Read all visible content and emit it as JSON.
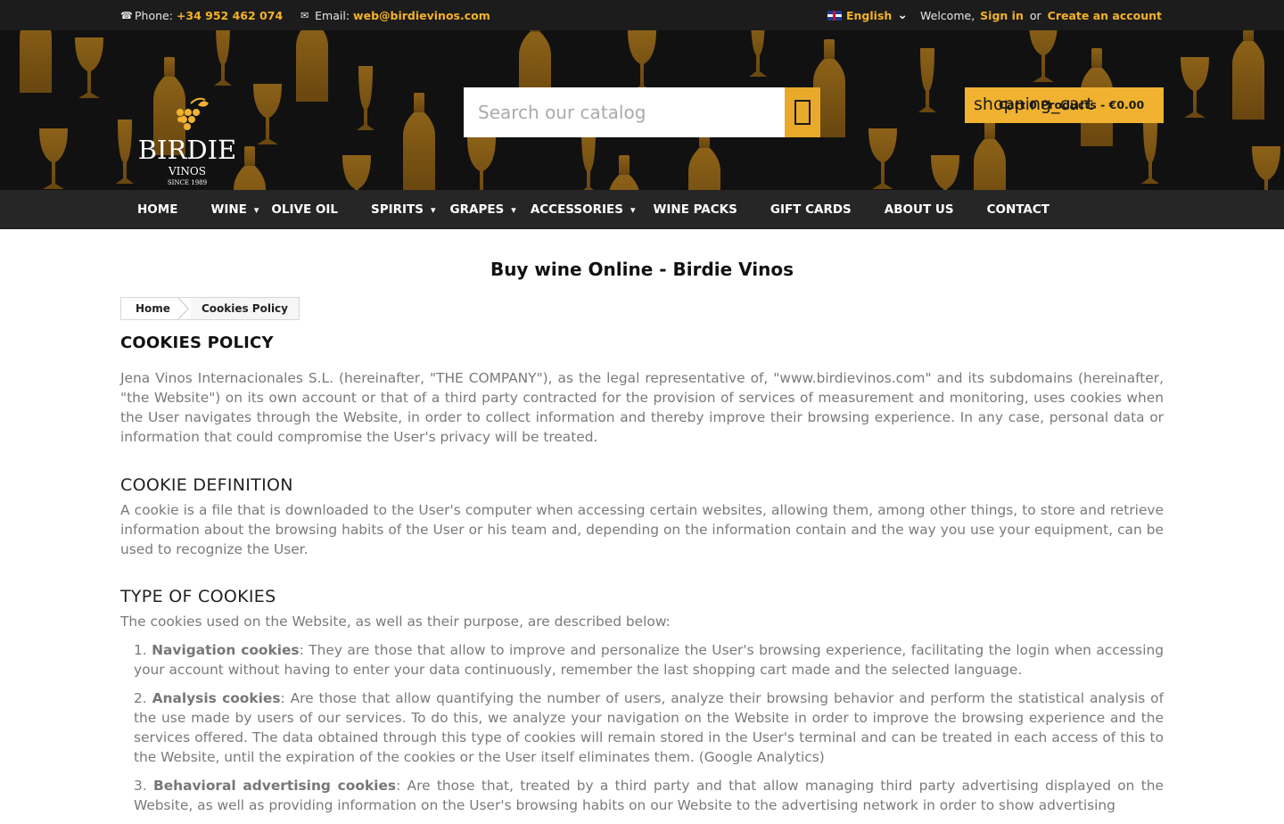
{
  "topbar": {
    "phone_label": "Phone:",
    "phone_value": "+34 952 462 074",
    "email_label": "Email:",
    "email_value": "web@birdievinos.com",
    "language": "English",
    "welcome": "Welcome,",
    "sign_in": "Sign in",
    "or": "or",
    "create_account": "Create an account"
  },
  "header": {
    "logo_name": "BIRDIE",
    "logo_sub": "VINOS",
    "logo_since": "SINCE 1989",
    "search_placeholder": "Search our catalog",
    "cart_icon_text": "shopping_cart",
    "cart_label": "Cart 0 Products - €0.00"
  },
  "nav": {
    "items": [
      {
        "label": "HOME",
        "dropdown": false
      },
      {
        "label": "WINE",
        "dropdown": true
      },
      {
        "label": "OLIVE OIL",
        "dropdown": false
      },
      {
        "label": "SPIRITS",
        "dropdown": true
      },
      {
        "label": "GRAPES",
        "dropdown": true
      },
      {
        "label": "ACCESSORIES",
        "dropdown": true
      },
      {
        "label": "WINE PACKS",
        "dropdown": false
      },
      {
        "label": "GIFT CARDS",
        "dropdown": false
      },
      {
        "label": "ABOUT US",
        "dropdown": false
      },
      {
        "label": "CONTACT",
        "dropdown": false
      }
    ]
  },
  "main": {
    "page_title": "Buy wine Online - Birdie Vinos",
    "breadcrumb": [
      "Home",
      "Cookies Policy"
    ],
    "heading": "COOKIES POLICY",
    "intro": "Jena Vinos Internacionales S.L. (hereinafter, \"THE COMPANY\"), as the legal representative of, \"www.birdievinos.com\" and its subdomains (hereinafter, \"the Website\") on its own account or that of a third party contracted for the provision of services of measurement and monitoring, uses cookies when the User navigates through the Website, in order to collect information and thereby improve their browsing experience. In any case, personal data or information that could compromise the User's privacy will be treated.",
    "definition_heading": "COOKIE DEFINITION",
    "definition_text": "A cookie is a file that is downloaded to the User's computer when accessing certain websites, allowing them, among other things, to store and retrieve information about the browsing habits of the User or his team and, depending on the information contain and the way you use your equipment, can be used to recognize the User.",
    "types_heading": "TYPE OF COOKIES",
    "types_intro": "The cookies used on the Website, as well as their purpose, are described below:",
    "types": [
      {
        "num": "1.",
        "name": "Navigation cookies",
        "text": ": They are those that allow to improve and personalize the User's browsing experience, facilitating the login when accessing your account without having to enter your data continuously, remember the last shopping cart made and the selected language."
      },
      {
        "num": "2.",
        "name": "Analysis cookies",
        "text": ": Are those that allow quantifying the number of users, analyze their browsing behavior and perform the statistical analysis of the use made by users of our services. To do this, we analyze your navigation on the Website in order to improve the browsing experience and the services offered. The data obtained through this type of cookies will remain stored in the User's terminal and can be treated in each access of this to the Website, until the expiration of the cookies or the User itself eliminates them. (Google Analytics)"
      },
      {
        "num": "3.",
        "name": "Behavioral advertising cookies",
        "text": ": Are those that, treated by a third party and that allow managing third party advertising displayed on the Website, as well as providing information on the User's browsing habits on our Website to the advertising network in order to show advertising"
      }
    ]
  },
  "colors": {
    "accent": "#f5b227",
    "topbar_bg": "#1c1c1c",
    "nav_bg": "#262626",
    "body_text": "#7a7a7a"
  }
}
